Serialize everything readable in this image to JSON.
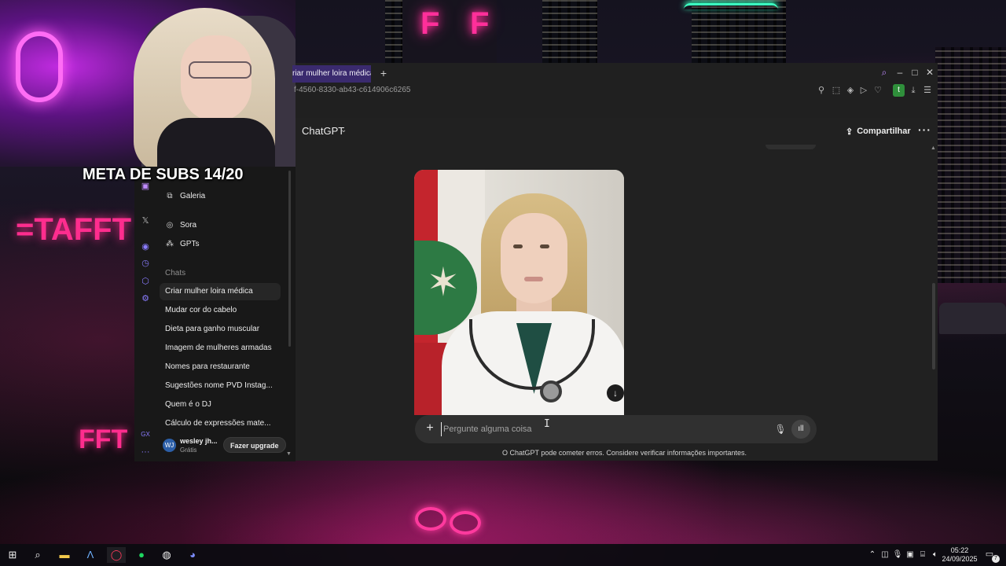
{
  "stream_overlay": {
    "text": "META DE SUBS 14/20"
  },
  "browser": {
    "tab_title": "riar mulher loira médica",
    "url_fragment": "f-4560-8330-ab43-c614906c6265",
    "profile_initial": "t"
  },
  "chatgpt": {
    "model_name": "ChatGPT",
    "share_label": "Compartilhar",
    "composer_placeholder": "Pergunte alguma coisa",
    "disclaimer": "O ChatGPT pode cometer erros. Considere verificar informações importantes.",
    "image_alt": "Retrato de médica loira com jaleco branco e estetoscópio diante de bandeira"
  },
  "sidebar": {
    "top_items": [
      {
        "label": "Galeria",
        "icon": "gallery-icon"
      },
      {
        "label": "Sora",
        "icon": "sora-icon"
      },
      {
        "label": "GPTs",
        "icon": "gpts-icon"
      }
    ],
    "section_label": "Chats",
    "chats": [
      "Criar mulher loira médica",
      "Mudar cor do cabelo",
      "Dieta para ganho muscular",
      "Imagem de mulheres armadas",
      "Nomes para restaurante",
      "Sugestões nome PVD Instag...",
      "Quem é o DJ",
      "Cálculo de expressões mate..."
    ],
    "user": {
      "initials": "WJ",
      "name": "wesley jh...",
      "plan": "Grátis",
      "upgrade_label": "Fazer upgrade"
    },
    "rail_label": "GX"
  },
  "taskbar": {
    "time": "05:22",
    "date": "24/09/2025",
    "notification_count": "7"
  },
  "colors": {
    "app_bg": "#212121",
    "sidebar_bg": "#181818",
    "composer_bg": "#303030",
    "tab_accent": "#3a2a6e"
  }
}
